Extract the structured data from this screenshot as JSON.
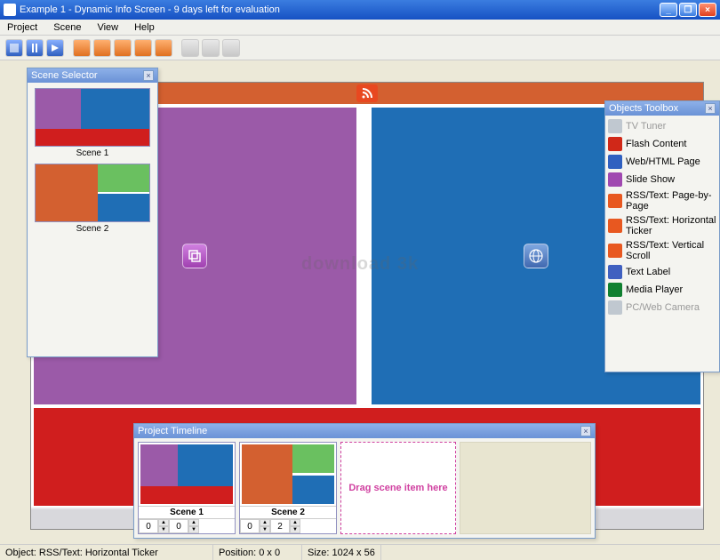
{
  "title": "Example 1 - Dynamic Info Screen - 9 days left for evaluation",
  "menu": [
    "Project",
    "Scene",
    "View",
    "Help"
  ],
  "panels": {
    "scene_selector": "Scene Selector",
    "objects_toolbox": "Objects Toolbox",
    "timeline": "Project Timeline"
  },
  "scenes": {
    "s1": "Scene 1",
    "s2": "Scene 2"
  },
  "tools": [
    {
      "label": "TV Tuner",
      "disabled": true,
      "color": "#c0c8d0"
    },
    {
      "label": "Flash Content",
      "disabled": false,
      "color": "#d02818"
    },
    {
      "label": "Web/HTML Page",
      "disabled": false,
      "color": "#3060c0"
    },
    {
      "label": "Slide Show",
      "disabled": false,
      "color": "#a048b0"
    },
    {
      "label": "RSS/Text: Page-by-Page",
      "disabled": false,
      "color": "#e85820"
    },
    {
      "label": "RSS/Text: Horizontal Ticker",
      "disabled": false,
      "color": "#e85820"
    },
    {
      "label": "RSS/Text: Vertical Scroll",
      "disabled": false,
      "color": "#e85820"
    },
    {
      "label": "Text Label",
      "disabled": false,
      "color": "#4060c0"
    },
    {
      "label": "Media Player",
      "disabled": false,
      "color": "#108030"
    },
    {
      "label": "PC/Web Camera",
      "disabled": true,
      "color": "#c0c8d0"
    }
  ],
  "timeline": {
    "drop_hint": "Drag scene item here",
    "vals": {
      "s1a": "0",
      "s1b": "0",
      "s2a": "0",
      "s2b": "2"
    }
  },
  "status": {
    "object": "Object: RSS/Text: Horizontal Ticker",
    "position": "Position: 0 x 0",
    "size": "Size: 1024 x 56"
  },
  "watermark": "download 3k"
}
